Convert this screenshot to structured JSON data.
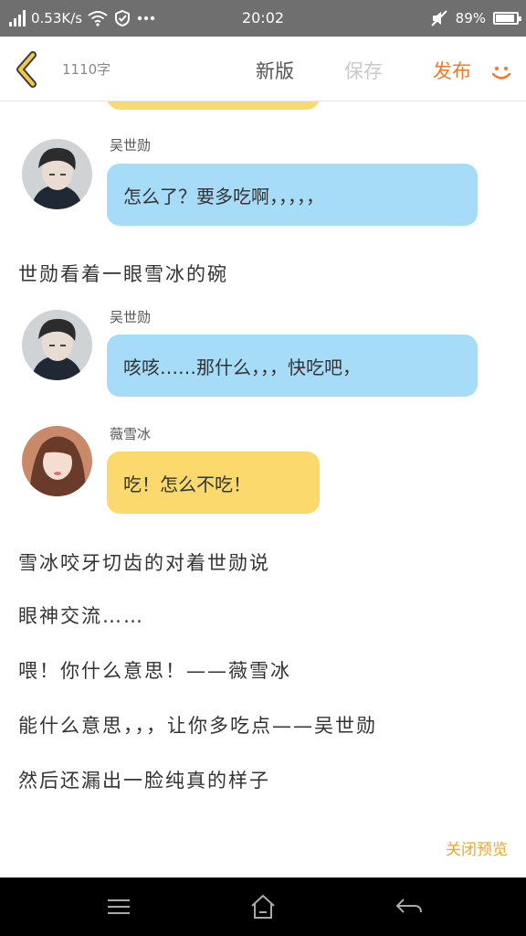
{
  "status": {
    "speed": "0.53K/s",
    "time": "20:02",
    "battery": "89%",
    "battery_level": 0.89
  },
  "header": {
    "word_count": "1110字",
    "new_version": "新版",
    "save": "保存",
    "publish": "发布"
  },
  "messages": [
    {
      "sender": "吴世勋",
      "text": "怎么了？要多吃啊，，，，，"
    },
    {
      "sender": "吴世勋",
      "text": "咳咳……那什么，，，快吃吧，"
    },
    {
      "sender": "薇雪冰",
      "text": "吃！怎么不吃！"
    }
  ],
  "narration": {
    "line1": "世勋看着一眼雪冰的碗",
    "line2": "雪冰咬牙切齿的对着世勋说",
    "line3": "眼神交流……",
    "line4": "喂！你什么意思！——薇雪冰",
    "line5": "能什么意思，，，让你多吃点——吴世勋",
    "line6": "然后还漏出一脸纯真的样子"
  },
  "footer": {
    "close_preview": "关闭预览"
  },
  "colors": {
    "accent": "#ef7a2e",
    "blue_bubble": "#a6dcf7",
    "yellow_bubble": "#fbd96c",
    "close_preview": "#f0a52a"
  },
  "icons": {
    "back": "chevron-left-icon",
    "smile": "smile-icon",
    "menu": "menu-icon",
    "home": "home-icon",
    "nav_back": "back-arrow-icon"
  }
}
